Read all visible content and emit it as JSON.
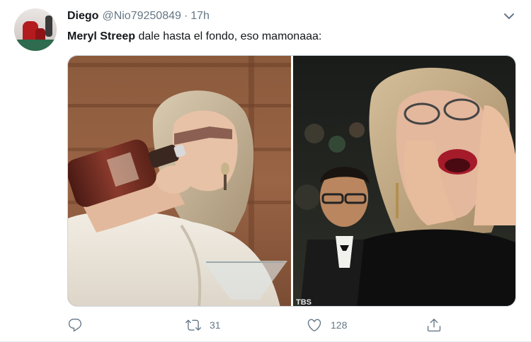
{
  "tweet": {
    "display_name": "Diego",
    "handle": "@Nio79250849",
    "separator": "·",
    "time": "17h",
    "text_bold": "Meryl Streep",
    "text_rest": " dale hasta el fondo, eso mamonaaa:",
    "watermark": "TBS"
  },
  "actions": {
    "reply_icon": "reply-icon",
    "retweet_icon": "retweet-icon",
    "retweet_count": "31",
    "like_icon": "heart-icon",
    "like_count": "128",
    "share_icon": "share-icon"
  },
  "colors": {
    "text_primary": "#14171a",
    "text_secondary": "#657786",
    "border": "#ccd6dd"
  }
}
